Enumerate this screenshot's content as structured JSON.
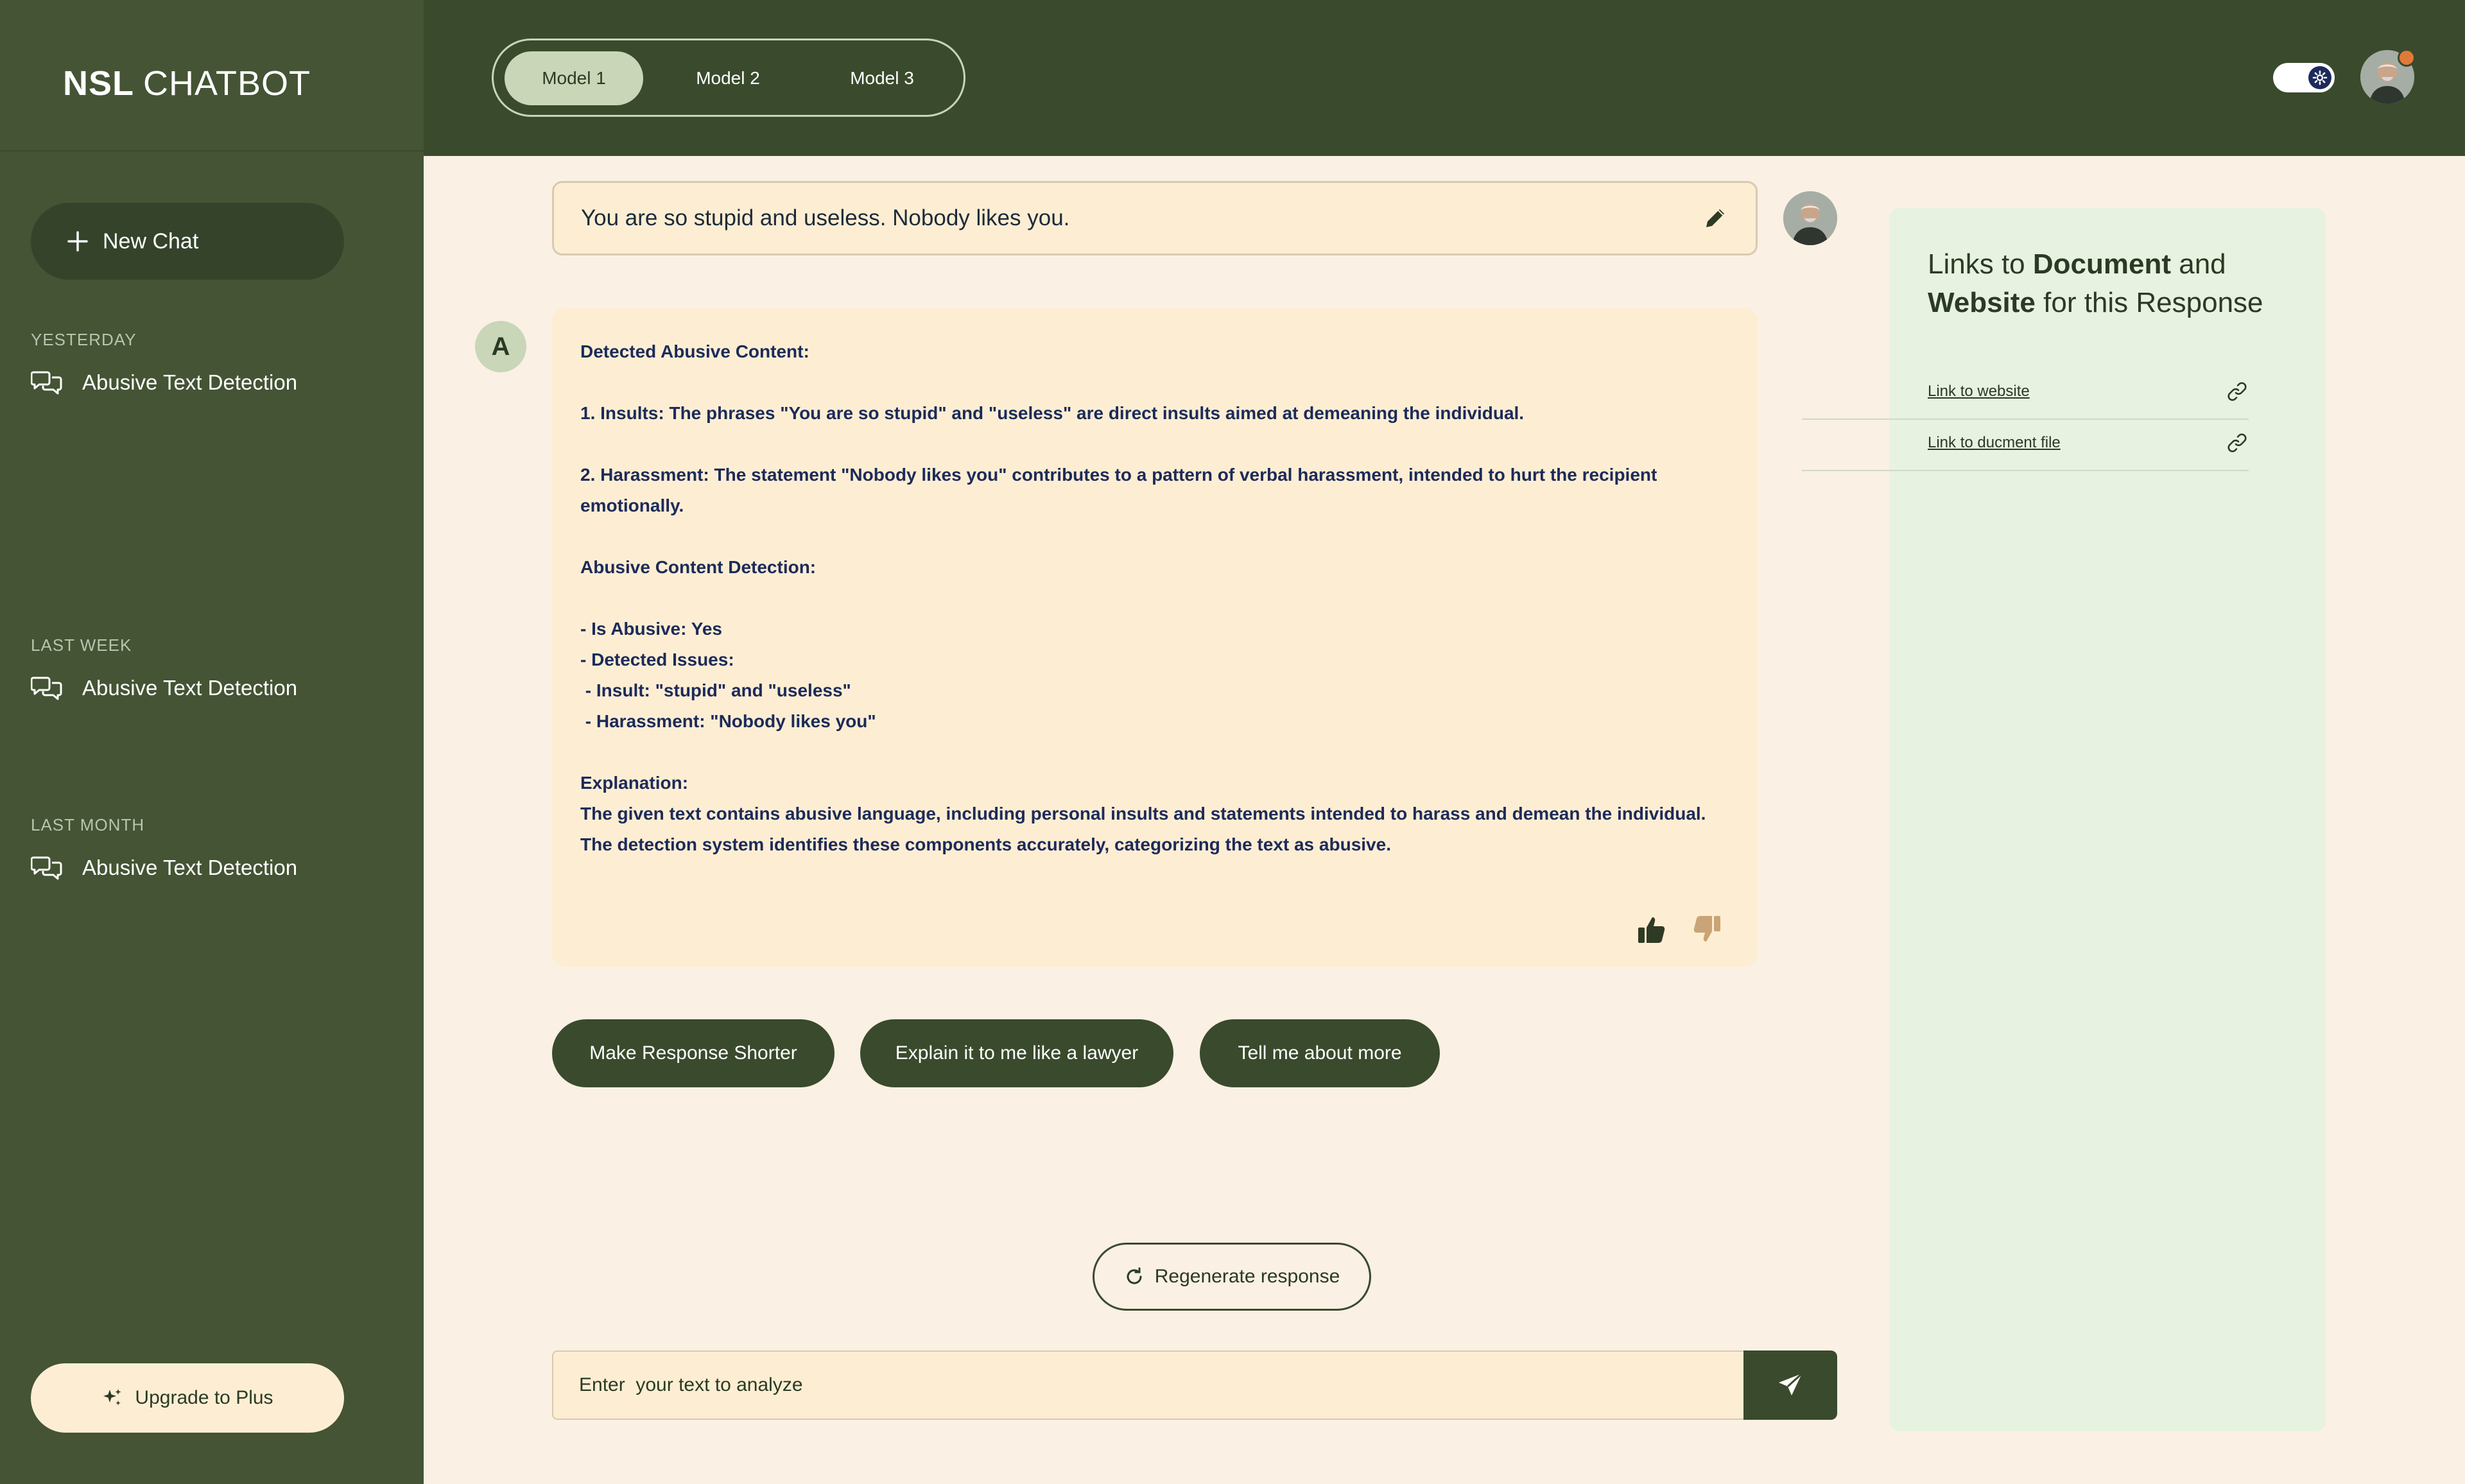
{
  "sidebar": {
    "brand_bold": "NSL",
    "brand_rest": "CHATBOT",
    "new_chat_label": "New Chat",
    "sections": [
      {
        "label": "YESTERDAY",
        "items": [
          {
            "label": "Abusive Text Detection"
          }
        ]
      },
      {
        "label": "LAST WEEK",
        "items": [
          {
            "label": "Abusive Text Detection"
          }
        ]
      },
      {
        "label": "LAST MONTH",
        "items": [
          {
            "label": "Abusive Text Detection"
          }
        ]
      }
    ],
    "upgrade_label": "Upgrade to Plus"
  },
  "header": {
    "models": [
      "Model 1",
      "Model 2",
      "Model 3"
    ],
    "active_model": "Model 1"
  },
  "chat": {
    "user_message": "You are so stupid and useless. Nobody likes you.",
    "bot_initial": "A",
    "bot_response": "Detected Abusive Content:\n\n1. Insults: The phrases \"You are so stupid\" and \"useless\" are direct insults aimed at demeaning the individual.\n\n2. Harassment: The statement \"Nobody likes you\" contributes to a pattern of verbal harassment, intended to hurt the recipient emotionally.\n\nAbusive Content Detection:\n\n- Is Abusive: Yes\n- Detected Issues:\n - Insult: \"stupid\" and \"useless\"\n - Harassment: \"Nobody likes you\"\n\nExplanation:\nThe given text contains abusive language, including personal insults and statements intended to harass and demean the individual.\nThe detection system identifies these components accurately, categorizing the text as abusive.",
    "suggestions": [
      "Make Response Shorter",
      "Explain it to me like a lawyer",
      "Tell me about more"
    ],
    "regenerate_label": "Regenerate response",
    "input_placeholder": "Enter  your text to analyze"
  },
  "links_panel": {
    "title_part1": "Links to ",
    "title_bold1": "Document",
    "title_part2": " and ",
    "title_bold2": "Website",
    "title_part3": " for this Response",
    "links": [
      {
        "label": "Link to website"
      },
      {
        "label": "Link to ducment file"
      }
    ]
  },
  "colors": {
    "sidebar_bg": "#445434",
    "header_bg": "#3a4a2c",
    "page_bg": "#faf0e4",
    "bubble_bg": "#fdeed3",
    "panel_bg": "#e8f2e0",
    "accent_dark": "#3a4a2c"
  }
}
